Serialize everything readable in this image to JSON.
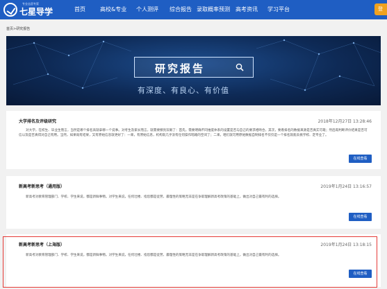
{
  "header": {
    "logo_name": "七星导学",
    "logo_tagline": "专业志愿专家",
    "nav": [
      {
        "label": "首页",
        "name": "nav-home"
      },
      {
        "label": "高校&专业",
        "name": "nav-colleges"
      },
      {
        "label": "个人测评",
        "name": "nav-assessment"
      },
      {
        "label": "综合报告",
        "name": "nav-report"
      },
      {
        "label": "录取概率预测",
        "name": "nav-admission-prediction"
      },
      {
        "label": "高考资讯",
        "name": "nav-news"
      },
      {
        "label": "学习平台",
        "name": "nav-study"
      }
    ],
    "login_label": "登"
  },
  "breadcrumb": "首页>研究报告",
  "banner": {
    "title": "研究报告",
    "subtitle": "有深度、有良心、有价值"
  },
  "articles": [
    {
      "title": "大学排名及评级研究",
      "date": "2018年12月27日 13:28:46",
      "body": "对大学，在校生、毕业生而言，当然是哪个排名高就拿哪一个说事。对考生及家长而言，就需要擦亮双眼了：首先，需要明确不同维度体系的设置是否与自己的要求相吻合，其次，要看排名的数据来源是否真实可靠；然后再判断评价结果是否可信以及是否真得对自己有用。当然，如果既有结果，又有原始信息就更好了：一来，有原始信息，机构就几乎没有任何操作暗箱的空间了；二来，咱们就可用原始数据自制排名不仅仅是一个排名就能去挑学校、定专业了。",
      "button_label": "在线查看"
    },
    {
      "title": "新高考新思考（通用版）",
      "date": "2019年1月24日 13:16:57",
      "body": "新高考对教育管理部门、学校、学生来说，都是新鲜事物。对学生来说，任何壮楼、指您都是徒劳，最理性的策略无非是在争取理解新高考政策的基础上，做出对自己最有利的选择。",
      "button_label": "在线查看"
    },
    {
      "title": "新高考新思考（上海版）",
      "date": "2019年1月24日 13:18:15",
      "body": "新高考对教育管理部门、学校、学生来说，都是新鲜事物。对学生来说，任何壮楼、指您都是徒劳，最理性的策略无非是在争取理解新高考政策的基础上，做出对自己最有利的选择。",
      "button_label": "在线查看"
    }
  ],
  "colors": {
    "brand_blue": "#1f5ec3",
    "login_orange": "#f0a11f",
    "highlight_red": "#e53935"
  }
}
